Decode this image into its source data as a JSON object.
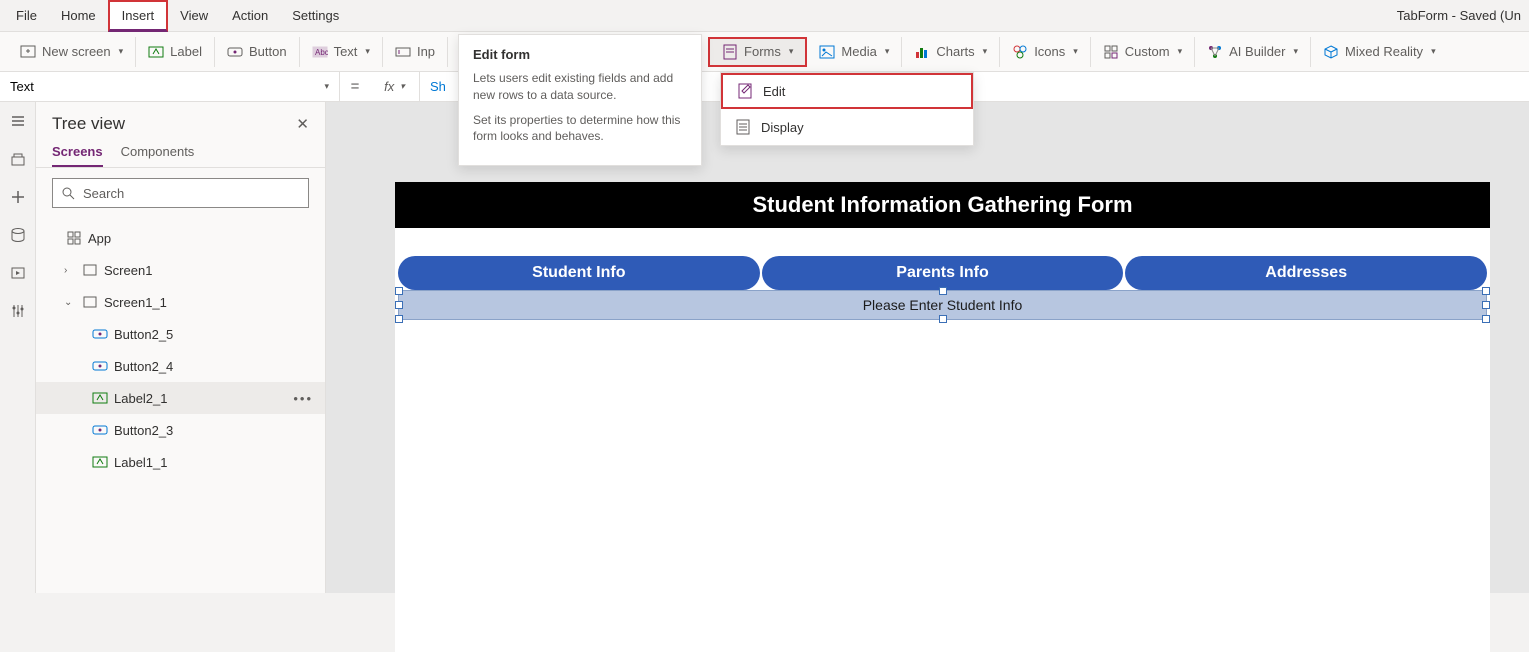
{
  "menubar": {
    "items": [
      "File",
      "Home",
      "Insert",
      "View",
      "Action",
      "Settings"
    ],
    "active_index": 2,
    "doc_title": "TabForm - Saved (Un"
  },
  "ribbon": {
    "new_screen": "New screen",
    "label": "Label",
    "button": "Button",
    "text": "Text",
    "input_partial": "Inp",
    "forms": "Forms",
    "media": "Media",
    "charts": "Charts",
    "icons": "Icons",
    "custom": "Custom",
    "ai_builder": "AI Builder",
    "mixed_reality": "Mixed Reality"
  },
  "tooltip": {
    "title": "Edit form",
    "line1": "Lets users edit existing fields and add new rows to a data source.",
    "line2": "Set its properties to determine how this form looks and behaves."
  },
  "forms_dropdown": {
    "edit": "Edit",
    "display": "Display"
  },
  "formula": {
    "property": "Text",
    "fx": "fx",
    "value": "Sh"
  },
  "treepanel": {
    "title": "Tree view",
    "tabs": [
      "Screens",
      "Components"
    ],
    "search_placeholder": "Search",
    "app": "App",
    "items": [
      {
        "label": "Screen1",
        "level": 1,
        "caret": "›",
        "icon": "screen"
      },
      {
        "label": "Screen1_1",
        "level": 1,
        "caret": "⌄",
        "icon": "screen"
      },
      {
        "label": "Button2_5",
        "level": 2,
        "icon": "button"
      },
      {
        "label": "Button2_4",
        "level": 2,
        "icon": "button"
      },
      {
        "label": "Label2_1",
        "level": 2,
        "icon": "label",
        "selected": true
      },
      {
        "label": "Button2_3",
        "level": 2,
        "icon": "button"
      },
      {
        "label": "Label1_1",
        "level": 2,
        "icon": "label"
      }
    ]
  },
  "canvas": {
    "form_title": "Student Information Gathering Form",
    "tabs": [
      "Student Info",
      "Parents Info",
      "Addresses"
    ],
    "placeholder": "Please Enter Student Info"
  }
}
